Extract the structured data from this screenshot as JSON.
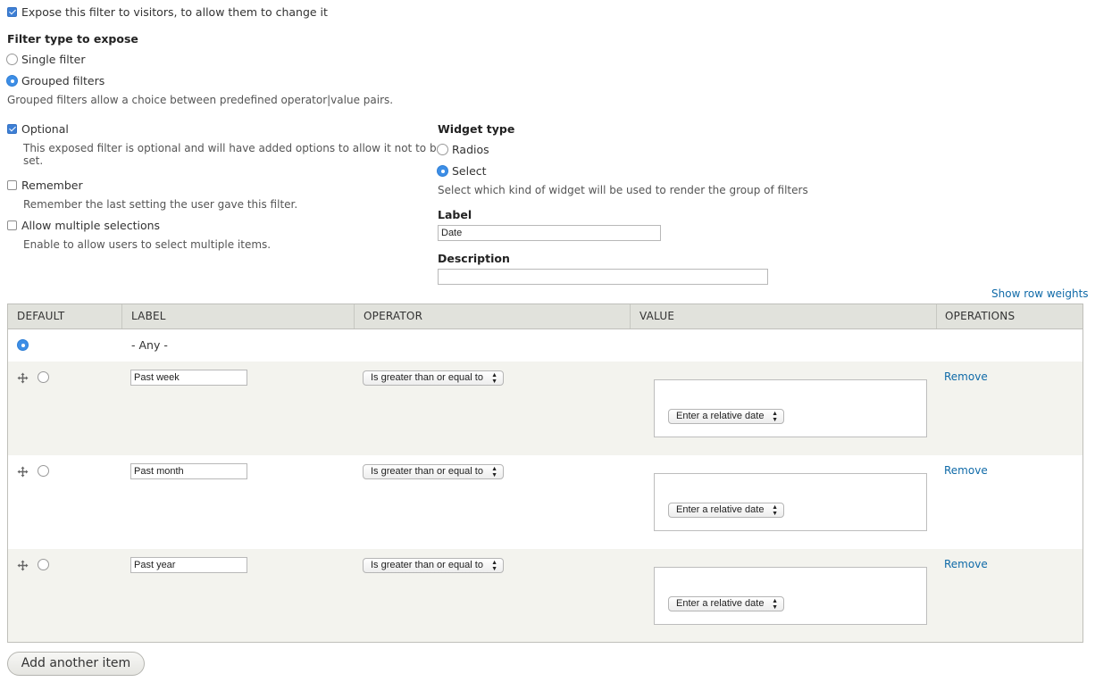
{
  "expose": {
    "label": "Expose this filter to visitors, to allow them to change it",
    "checked": true
  },
  "filter_type": {
    "heading": "Filter type to expose",
    "options": [
      {
        "label": "Single filter",
        "selected": false
      },
      {
        "label": "Grouped filters",
        "selected": true
      }
    ],
    "description": "Grouped filters allow a choice between predefined operator|value pairs."
  },
  "options": {
    "optional": {
      "label": "Optional",
      "checked": true,
      "description_line1": "This exposed filter is optional and will have added options to allow it not to be",
      "description_line2": "set."
    },
    "remember": {
      "label": "Remember",
      "checked": false,
      "description": "Remember the last setting the user gave this filter."
    },
    "multiple": {
      "label": "Allow multiple selections",
      "checked": false,
      "description": "Enable to allow users to select multiple items."
    }
  },
  "widget_type": {
    "heading": "Widget type",
    "options": [
      {
        "label": "Radios",
        "selected": false
      },
      {
        "label": "Select",
        "selected": true
      }
    ],
    "description": "Select which kind of widget will be used to render the group of filters"
  },
  "label_field": {
    "heading": "Label",
    "value": "Date"
  },
  "description_field": {
    "heading": "Description",
    "value": ""
  },
  "show_row_weights": "Show row weights",
  "table": {
    "headers": [
      "DEFAULT",
      "LABEL",
      "OPERATOR",
      "VALUE",
      "OPERATIONS"
    ],
    "any_row": {
      "label": "- Any -",
      "default_selected": true
    },
    "rows": [
      {
        "label": "Past week",
        "operator": "Is greater than or equal to",
        "value_placeholder": "Enter a relative date",
        "operation": "Remove"
      },
      {
        "label": "Past month",
        "operator": "Is greater than or equal to",
        "value_placeholder": "Enter a relative date",
        "operation": "Remove"
      },
      {
        "label": "Past year",
        "operator": "Is greater than or equal to",
        "value_placeholder": "Enter a relative date",
        "operation": "Remove"
      }
    ]
  },
  "add_button": "Add another item",
  "colors": {
    "accent": "#3d8ee6",
    "link": "#0f6aa8",
    "header_bg": "#e1e2dc",
    "striped_row_bg": "#f3f3ee"
  }
}
